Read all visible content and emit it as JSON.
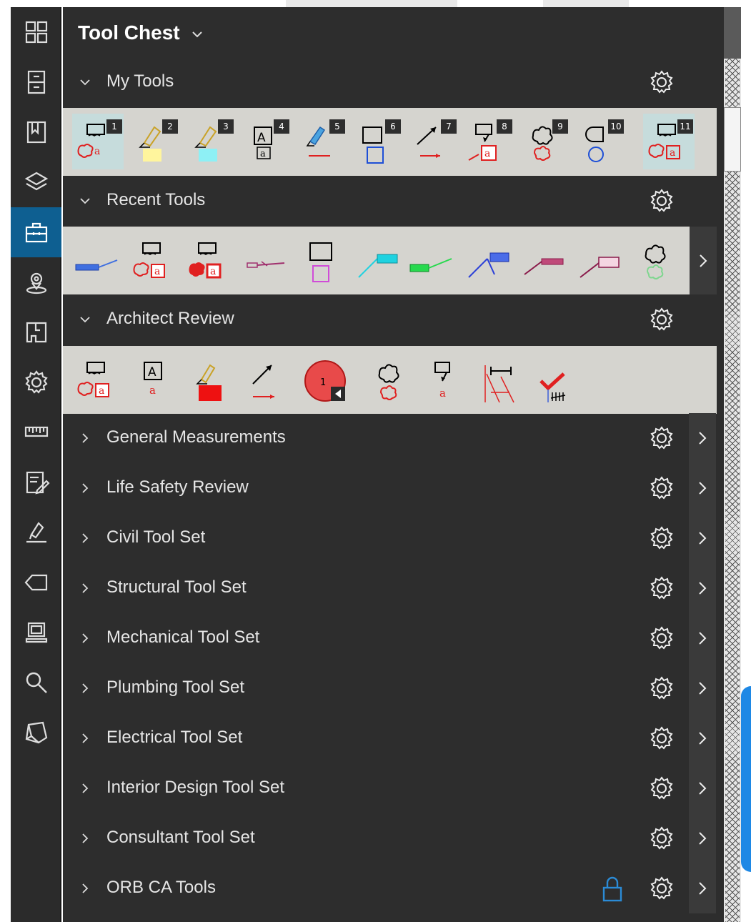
{
  "panel": {
    "title": "Tool Chest",
    "sections": [
      {
        "label": "My Tools",
        "expanded": true
      },
      {
        "label": "Recent Tools",
        "expanded": true
      },
      {
        "label": "Architect Review",
        "expanded": true
      },
      {
        "label": "General Measurements",
        "expanded": false
      },
      {
        "label": "Life Safety Review",
        "expanded": false
      },
      {
        "label": "Civil Tool Set",
        "expanded": false
      },
      {
        "label": "Structural Tool Set",
        "expanded": false
      },
      {
        "label": "Mechanical Tool Set",
        "expanded": false
      },
      {
        "label": "Plumbing Tool Set",
        "expanded": false
      },
      {
        "label": "Electrical Tool Set",
        "expanded": false
      },
      {
        "label": "Interior Design Tool Set",
        "expanded": false
      },
      {
        "label": "Consultant Tool Set",
        "expanded": false
      },
      {
        "label": "ORB CA Tools",
        "expanded": false,
        "locked": true
      }
    ]
  },
  "my_tools": {
    "badges": [
      "1",
      "2",
      "3",
      "4",
      "5",
      "6",
      "7",
      "8",
      "9",
      "10",
      "11"
    ]
  },
  "architect_review": {
    "count_badge": "1"
  },
  "rail": {
    "items": [
      "thumbnails-icon",
      "file-cabinet-icon",
      "bookmarks-icon",
      "layers-icon",
      "tool-chest-icon",
      "places-icon",
      "spaces-icon",
      "properties-icon",
      "measurements-icon",
      "markups-list-icon",
      "signatures-icon",
      "tags-icon",
      "studio-icon",
      "search-icon",
      "3d-icon"
    ],
    "active": "tool-chest-icon"
  },
  "colors": {
    "panel_bg": "#2d2d2d",
    "tray_bg": "#d5d4cf",
    "rail_active": "#0e5f91",
    "lock": "#2b8bd6"
  }
}
